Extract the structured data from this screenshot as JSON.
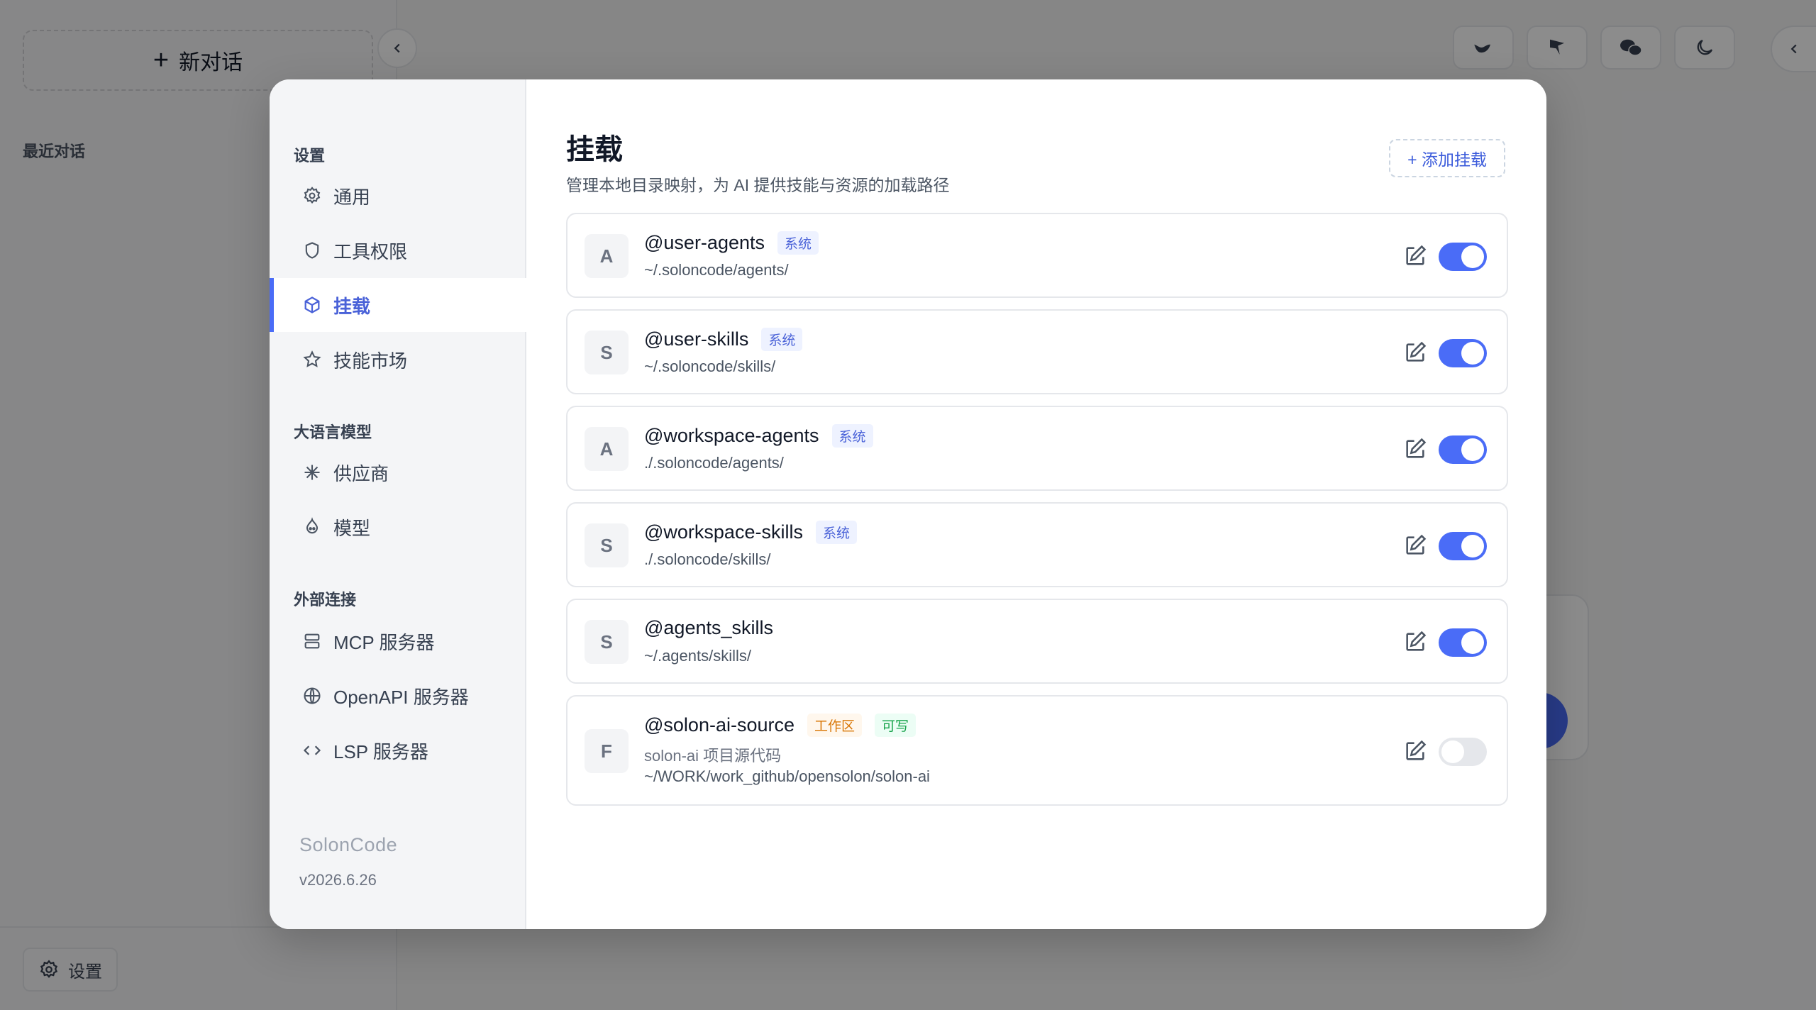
{
  "app": {
    "new_chat": "新对话",
    "recent_label": "最近对话",
    "settings_label": "设置"
  },
  "settings": {
    "sections": [
      {
        "title": "设置",
        "items": [
          {
            "label": "通用",
            "icon": "gear-icon"
          },
          {
            "label": "工具权限",
            "icon": "shield-icon"
          },
          {
            "label": "挂载",
            "icon": "cube-icon",
            "active": true
          },
          {
            "label": "技能市场",
            "icon": "star-icon"
          }
        ]
      },
      {
        "title": "大语言模型",
        "items": [
          {
            "label": "供应商",
            "icon": "asterisk-icon"
          },
          {
            "label": "模型",
            "icon": "model-icon"
          }
        ]
      },
      {
        "title": "外部连接",
        "items": [
          {
            "label": "MCP 服务器",
            "icon": "server-icon"
          },
          {
            "label": "OpenAPI 服务器",
            "icon": "globe-icon"
          },
          {
            "label": "LSP 服务器",
            "icon": "code-icon"
          }
        ]
      }
    ],
    "brand": "SolonCode",
    "version": "v2026.6.26"
  },
  "page": {
    "title": "挂载",
    "description": "管理本地目录映射，为 AI 提供技能与资源的加载路径",
    "add_button": "+ 添加挂载"
  },
  "mounts": [
    {
      "avatar": "A",
      "name": "@user-agents",
      "badges": [
        "系统"
      ],
      "path": "~/.soloncode/agents/",
      "enabled": true
    },
    {
      "avatar": "S",
      "name": "@user-skills",
      "badges": [
        "系统"
      ],
      "path": "~/.soloncode/skills/",
      "enabled": true
    },
    {
      "avatar": "A",
      "name": "@workspace-agents",
      "badges": [
        "系统"
      ],
      "path": "./.soloncode/agents/",
      "enabled": true
    },
    {
      "avatar": "S",
      "name": "@workspace-skills",
      "badges": [
        "系统"
      ],
      "path": "./.soloncode/skills/",
      "enabled": true
    },
    {
      "avatar": "S",
      "name": "@agents_skills",
      "badges": [],
      "path": "~/.agents/skills/",
      "enabled": true
    },
    {
      "avatar": "F",
      "name": "@solon-ai-source",
      "badges": [
        "工作区",
        "可写"
      ],
      "description": "solon-ai 项目源代码",
      "path": "~/WORK/work_github/opensolon/solon-ai",
      "enabled": false
    }
  ],
  "colors": {
    "accent": "#4a6cf7",
    "overlay": "rgba(0,0,0,0.45)"
  }
}
